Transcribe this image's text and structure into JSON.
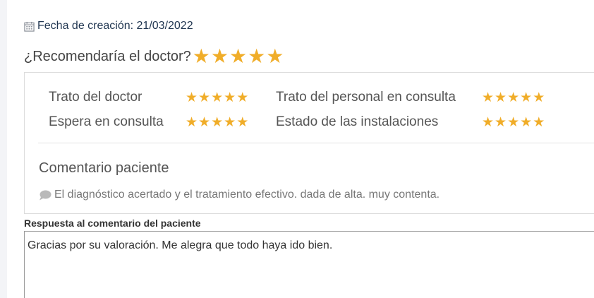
{
  "review": {
    "date_label": "Fecha de creación: 21/03/2022",
    "recommend_label": "¿Recomendaría el doctor?",
    "recommend_stars": 5,
    "ratings": [
      {
        "label": "Trato del doctor",
        "stars": 5
      },
      {
        "label": "Trato del personal en consulta",
        "stars": 5
      },
      {
        "label": "Espera en consulta",
        "stars": 5
      },
      {
        "label": "Estado de las instalaciones",
        "stars": 5
      }
    ],
    "comment_title": "Comentario paciente",
    "comment_text": "El diagnóstico acertado y el tratamiento efectivo. dada de alta. muy contenta.",
    "reply_label": "Respuesta al comentario del paciente",
    "reply_value": "Gracias por su valoración. Me alegra que todo haya ido bien."
  },
  "icons": {
    "date": "calendar-icon",
    "comment": "comment-bubble-icon",
    "star": "star-icon"
  },
  "colors": {
    "star": "#f0ad29",
    "date_text": "#1f3550",
    "label_text": "#555555",
    "comment_text": "#777777"
  }
}
